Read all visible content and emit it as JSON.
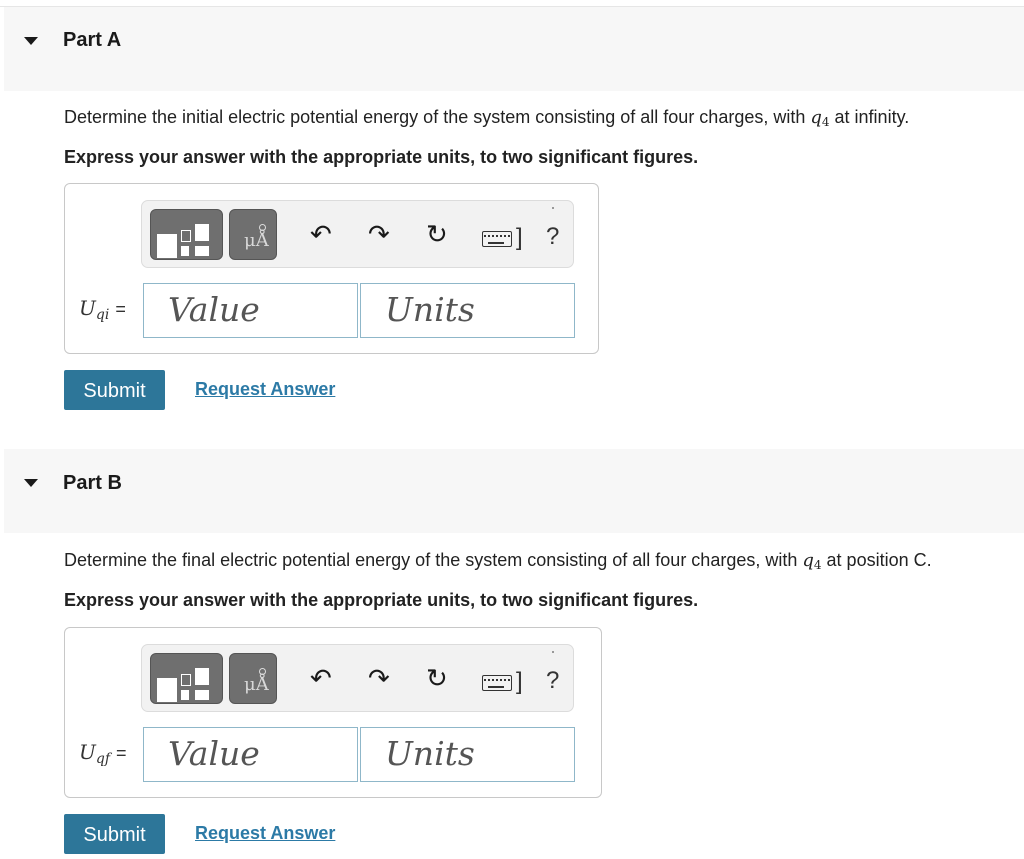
{
  "colors": {
    "header_bg": "#f7f7f7",
    "submit_bg": "#2d7699",
    "link": "#2c7aa6",
    "toolbar_button": "#6f6f6f",
    "field_border": "#8fb7c9"
  },
  "icons": {
    "caret": "caret-down-icon",
    "templates": "templates-icon",
    "symbols": "symbols-icon",
    "undo": "undo-icon",
    "redo": "redo-icon",
    "reset": "reset-icon",
    "keyboard": "keyboard-icon",
    "help": "help-icon"
  },
  "parts": [
    {
      "title": "Part A",
      "question_before": "Determine the initial electric potential energy of the system consisting of all four charges, with ",
      "charge_var": "q",
      "charge_sub": "4",
      "question_after": " at infinity.",
      "instruction": "Express your answer with the appropriate units, to two significant figures.",
      "answer": {
        "var": "U",
        "var_sub": "qi",
        "equals": "=",
        "value_placeholder": "Value",
        "units_placeholder": "Units"
      },
      "symbols_label": "μÅ",
      "keyboard_mark": "]",
      "help_label": "?",
      "submit_label": "Submit",
      "request_label": "Request Answer"
    },
    {
      "title": "Part B",
      "question_before": "Determine the final electric potential energy of the system consisting of all four charges, with ",
      "charge_var": "q",
      "charge_sub": "4",
      "question_after": " at position C.",
      "instruction": "Express your answer with the appropriate units, to two significant figures.",
      "answer": {
        "var": "U",
        "var_sub": "qf",
        "equals": "=",
        "value_placeholder": "Value",
        "units_placeholder": "Units"
      },
      "symbols_label": "μÅ",
      "keyboard_mark": "]",
      "help_label": "?",
      "submit_label": "Submit",
      "request_label": "Request Answer"
    }
  ]
}
